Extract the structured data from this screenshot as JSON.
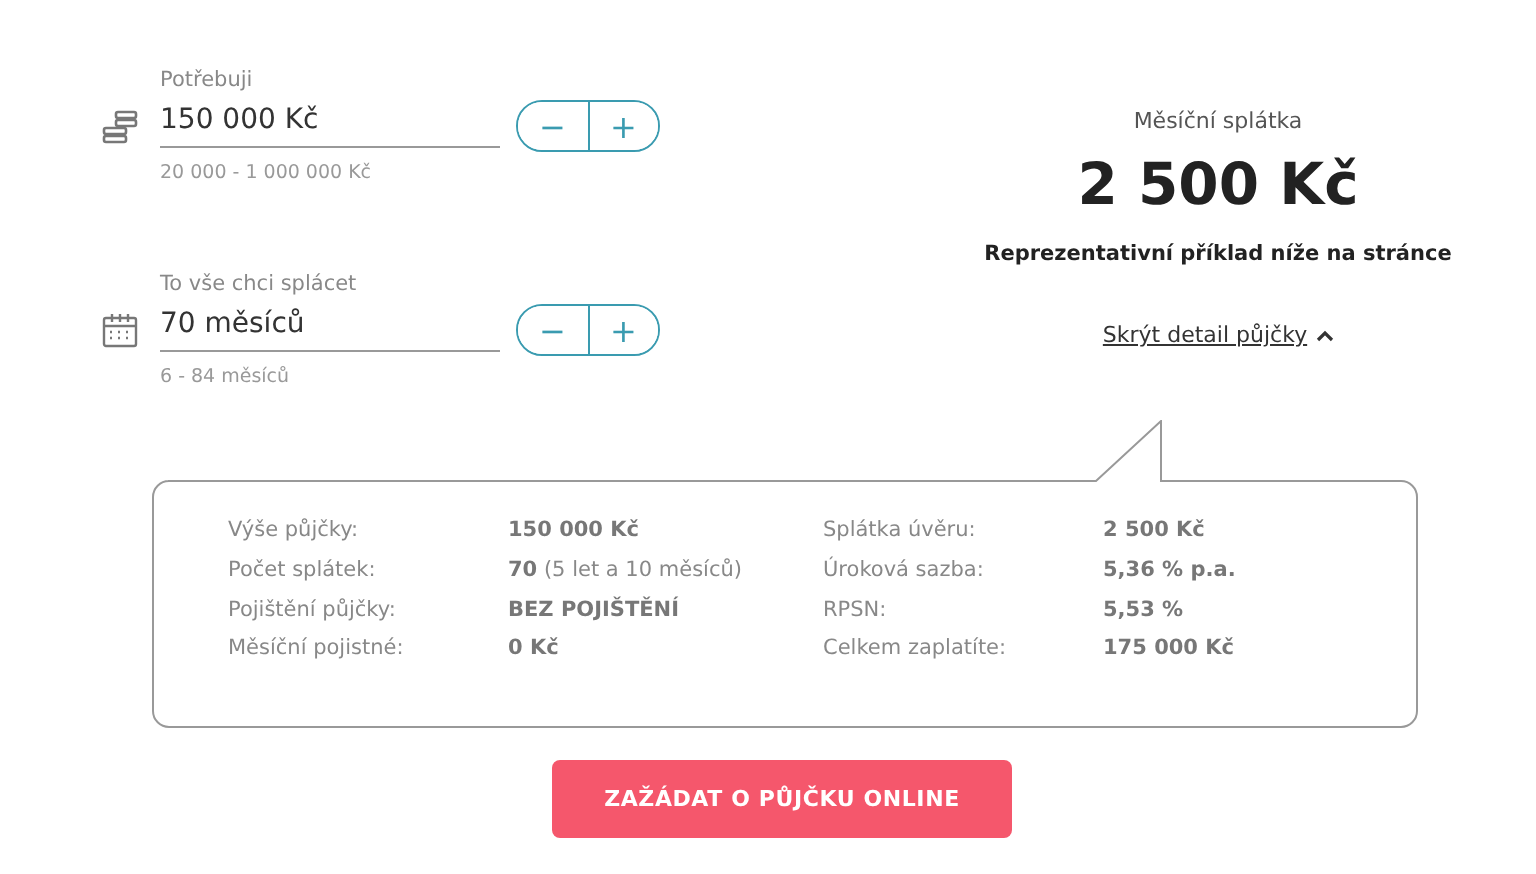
{
  "inputs": [
    {
      "kind": "money",
      "label": "Potřebuji",
      "value": "150 000 Kč",
      "range": "20 000 - 1 000 000 Kč",
      "minus": "−",
      "plus": "+"
    },
    {
      "kind": "calendar",
      "label": "To vše chci splácet",
      "value": "70 měsíců",
      "range": "6 - 84 měsíců",
      "minus": "−",
      "plus": "+"
    }
  ],
  "summary": {
    "label": "Měsíční splátka",
    "amount": "2 500 Kč",
    "note": "Reprezentativní příklad níže na stránce",
    "toggle": "Skrýt detail půjčky",
    "expanded": true
  },
  "details": {
    "left": [
      {
        "label": "Výše půjčky:",
        "value": "**150 000 Kč**"
      },
      {
        "label": "Počet splátek:",
        "value": "**70** (5 let a 10 měsíců)"
      },
      {
        "label": "Pojištění půjčky:",
        "value": "**BEZ POJIŠTĚNÍ**"
      },
      {
        "label": "Měsíční pojistné:",
        "value": "**0 Kč**"
      }
    ],
    "right": [
      {
        "label": "Splátka úvěru:",
        "value": "**2 500 Kč**"
      },
      {
        "label": "Úroková sazba:",
        "value": "**5,36 % p.a.**"
      },
      {
        "label": "RPSN:",
        "value": "**5,53 %**"
      },
      {
        "label": "Celkem zaplatíte:",
        "value": "**175 000 Kč**"
      }
    ]
  },
  "button": "ZAŽÁDAT O PŮJČKU ONLINE"
}
